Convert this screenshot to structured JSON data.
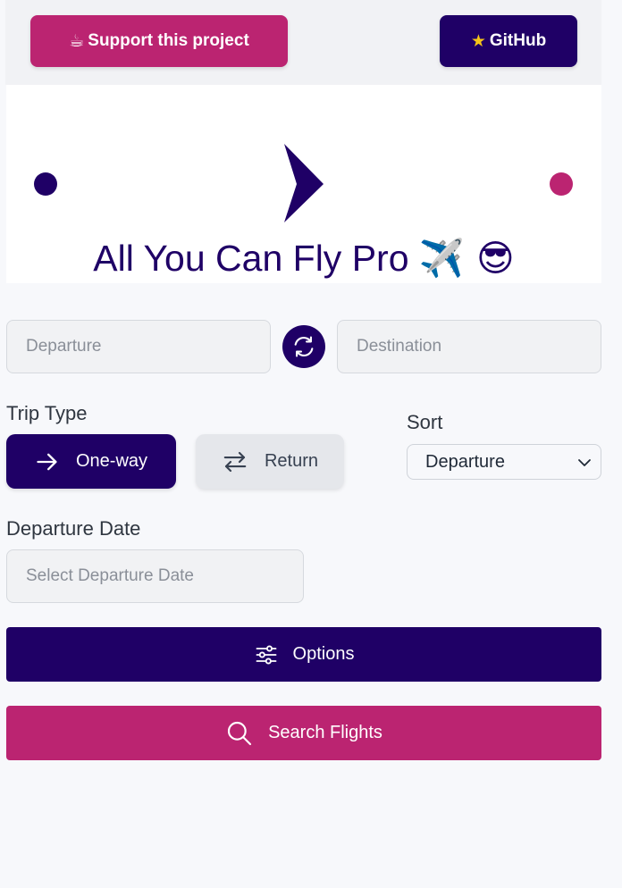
{
  "header": {
    "support_label": "Support this project",
    "support_icon": "coffee-icon",
    "github_label": "GitHub",
    "github_icon": "star-icon"
  },
  "hero": {
    "title": "All You Can Fly Pro",
    "title_emojis": "✈️ 😎",
    "line_colors": {
      "start": "#1f0066",
      "end": "#bb2471"
    }
  },
  "route": {
    "departure_placeholder": "Departure",
    "destination_placeholder": "Destination",
    "swap_icon": "swap-refresh-icon"
  },
  "trip_type": {
    "label": "Trip Type",
    "options": [
      {
        "label": "One-way",
        "icon": "arrow-right-icon",
        "selected": true
      },
      {
        "label": "Return",
        "icon": "arrows-exchange-icon",
        "selected": false
      }
    ]
  },
  "sort": {
    "label": "Sort",
    "selected": "Departure"
  },
  "departure_date": {
    "label": "Departure Date",
    "placeholder": "Select Departure Date"
  },
  "actions": {
    "options_label": "Options",
    "search_label": "Search Flights"
  },
  "colors": {
    "primary": "#1f0066",
    "accent": "#bb2471",
    "background": "#f7f8fb"
  }
}
